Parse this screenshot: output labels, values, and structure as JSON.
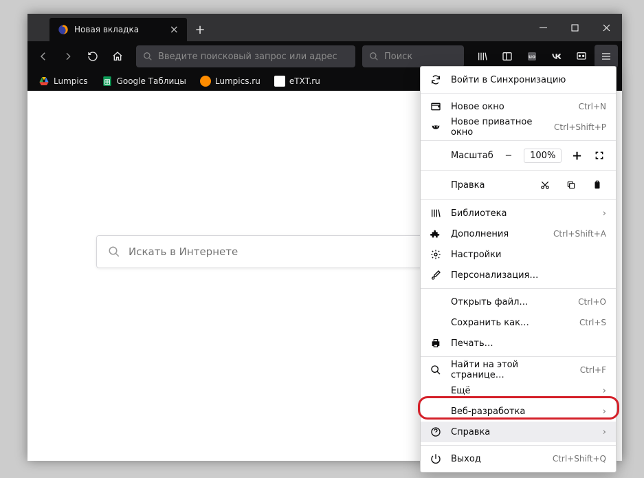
{
  "tab": {
    "title": "Новая вкладка"
  },
  "toolbar": {
    "addr_placeholder": "Введите поисковый запрос или адрес",
    "search_placeholder": "Поиск"
  },
  "bookmarks": [
    {
      "label": "Lumpics",
      "color": "#1a73e8",
      "icon": "drive"
    },
    {
      "label": "Google Таблицы",
      "color": "#0f9d58",
      "icon": "sheets"
    },
    {
      "label": "Lumpics.ru",
      "color": "#ff8c00",
      "icon": "lumpics"
    },
    {
      "label": "eTXT.ru",
      "color": "#e6e6e6",
      "icon": "etxt"
    }
  ],
  "content": {
    "search_placeholder": "Искать в Интернете"
  },
  "menu": {
    "sync": "Войти в Синхронизацию",
    "new_window": "Новое окно",
    "new_window_accel": "Ctrl+N",
    "new_private": "Новое приватное окно",
    "new_private_accel": "Ctrl+Shift+P",
    "zoom_label": "Масштаб",
    "zoom_value": "100%",
    "edit_label": "Правка",
    "library": "Библиотека",
    "addons": "Дополнения",
    "addons_accel": "Ctrl+Shift+A",
    "settings": "Настройки",
    "customize": "Персонализация…",
    "open_file": "Открыть файл…",
    "open_file_accel": "Ctrl+O",
    "save_as": "Сохранить как…",
    "save_as_accel": "Ctrl+S",
    "print": "Печать…",
    "find": "Найти на этой странице…",
    "find_accel": "Ctrl+F",
    "more": "Ещё",
    "webdev": "Веб-разработка",
    "help": "Справка",
    "quit": "Выход",
    "quit_accel": "Ctrl+Shift+Q"
  }
}
